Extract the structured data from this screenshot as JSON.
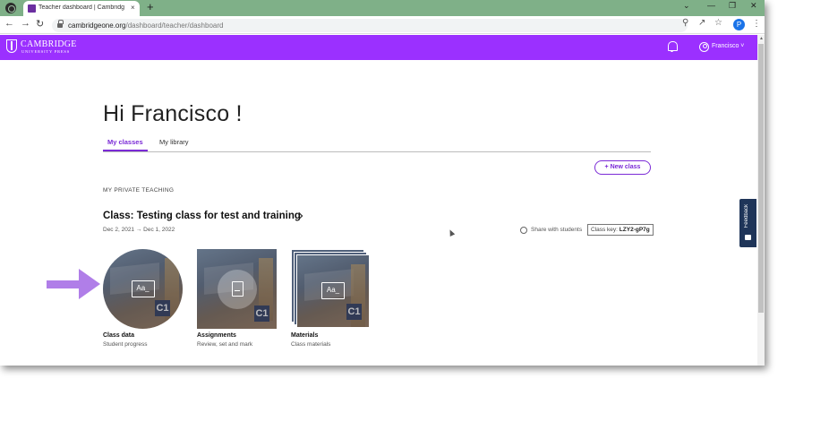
{
  "browser": {
    "tab_title": "Teacher dashboard | Cambridge",
    "tab_close": "×",
    "new_tab": "+",
    "url_host": "cambridgeone.org",
    "url_path": "/dashboard/teacher/dashboard",
    "profile_initial": "P",
    "minimize": "⌄",
    "min_btn": "—",
    "restore_btn": "❐",
    "close_btn": "✕"
  },
  "header": {
    "brand_line1": "CAMBRIDGE",
    "brand_line2": "UNIVERSITY PRESS",
    "user_name": "Francisco ˅"
  },
  "page": {
    "greeting": "Hi Francisco !",
    "tabs": [
      {
        "label": "My classes",
        "active": true
      },
      {
        "label": "My library",
        "active": false
      }
    ],
    "new_class_label": "+ New class",
    "section_label": "MY PRIVATE TEACHING",
    "class_title": "Class: Testing class for test and training",
    "dates": "Dec 2, 2021  →  Dec 1, 2022",
    "share_label": "Share with students",
    "class_key_label": "Class key:",
    "class_key_value": "LZY2-gP7g",
    "feedback": "Feedback",
    "cards": [
      {
        "title": "Class data",
        "subtitle": "Student progress",
        "cover_badge": "C1",
        "icon_text": "Aa_"
      },
      {
        "title": "Assignments",
        "subtitle": "Review, set and mark",
        "cover_badge": "C1"
      },
      {
        "title": "Materials",
        "subtitle": "Class materials",
        "cover_badge": "C1",
        "icon_text": "Aa_"
      }
    ]
  },
  "colors": {
    "brand_purple": "#9b30ff",
    "accent_purple": "#7b2bd6",
    "annotation_arrow": "#b07ee8",
    "feedback_navy": "#1f3559"
  }
}
